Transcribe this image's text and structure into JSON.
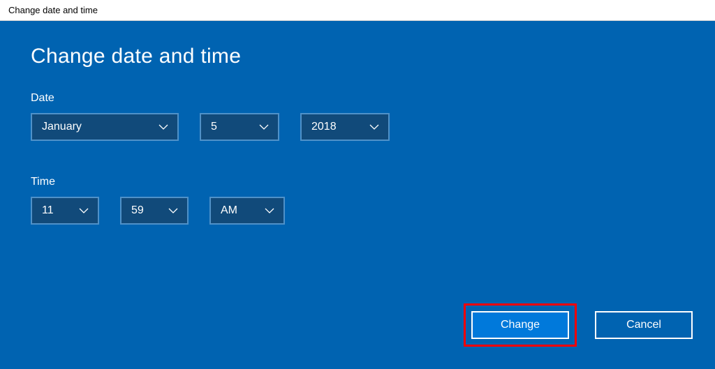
{
  "window": {
    "title": "Change date and time"
  },
  "heading": "Change date and time",
  "date": {
    "label": "Date",
    "month": "January",
    "day": "5",
    "year": "2018"
  },
  "time": {
    "label": "Time",
    "hour": "11",
    "minute": "59",
    "ampm": "AM"
  },
  "buttons": {
    "change": "Change",
    "cancel": "Cancel"
  }
}
